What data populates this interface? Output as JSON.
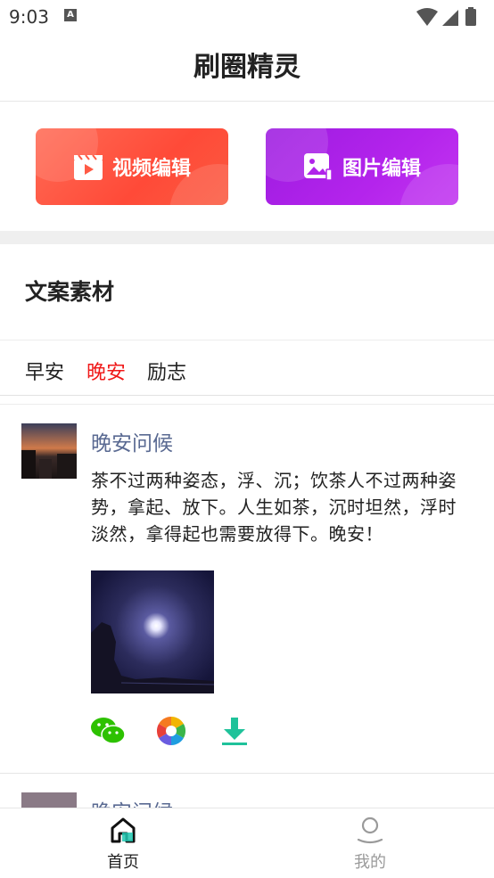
{
  "status_bar": {
    "time": "9:03",
    "badge": "A"
  },
  "header": {
    "title": "刷圈精灵"
  },
  "edit_buttons": {
    "video": {
      "label": "视频编辑",
      "icon": "video-clapper-icon",
      "color": "#ff5a45"
    },
    "photo": {
      "label": "图片编辑",
      "icon": "image-edit-icon",
      "color": "#b024ea"
    }
  },
  "section": {
    "title": "文案素材"
  },
  "tabs": [
    {
      "label": "早安",
      "active": false
    },
    {
      "label": "晚安",
      "active": true,
      "color": "#f01818"
    },
    {
      "label": "励志",
      "active": false
    }
  ],
  "posts": [
    {
      "title": "晚安问候",
      "body": "茶不过两种姿态，浮、沉；饮茶人不过两种姿势，拿起、放下。人生如茶，沉时坦然，浮时淡然，拿得起也需要放得下。晚安！",
      "actions": [
        "wechat-icon",
        "moments-icon",
        "download-icon"
      ]
    },
    {
      "title": "晚安问候"
    }
  ],
  "bottom_nav": [
    {
      "label": "首页",
      "icon": "home-icon",
      "active": true
    },
    {
      "label": "我的",
      "icon": "profile-icon",
      "active": false
    }
  ]
}
